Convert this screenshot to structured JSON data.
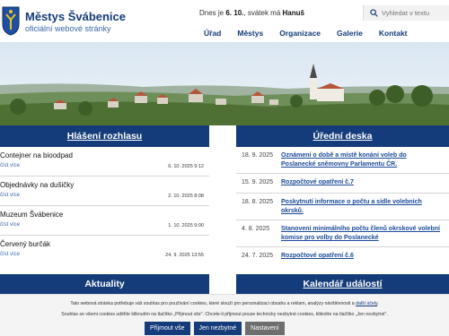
{
  "header": {
    "title": "Městys Švábenice",
    "subtitle": "oficiální webové stránky",
    "date_prefix": "Dnes je ",
    "date_value": "6. 10.",
    "date_mid": ", svátek má ",
    "name_day": "Hanuš"
  },
  "search": {
    "placeholder": "Vyhledat v textu",
    "icon": "search-icon"
  },
  "nav": [
    "Úřad",
    "Městys",
    "Organizace",
    "Galerie",
    "Kontakt"
  ],
  "announcements": {
    "heading": "Hlášení rozhlasu",
    "items": [
      {
        "title": "Contejner na bioodpad",
        "more": "číst více",
        "date": "6. 10. 2025 9:12"
      },
      {
        "title": "Objednávky na dušičky",
        "more": "číst více",
        "date": "2. 10. 2025 8:08"
      },
      {
        "title": "Muzeum Švábenice",
        "more": "číst více",
        "date": "1. 10. 2025 9:00"
      },
      {
        "title": "Červený burčák",
        "more": "číst více",
        "date": "24. 9. 2025 13:55"
      }
    ]
  },
  "board": {
    "heading": "Úřední deska",
    "items": [
      {
        "date": "18. 9. 2025",
        "title": "Oznámení o době a místě konání voleb do Poslanecké sněmovny Parlamentu ČR."
      },
      {
        "date": "15. 9. 2025",
        "title": "Rozpočtové opatření č.7"
      },
      {
        "date": "18. 8. 2025",
        "title": "Poskytnutí informace o počtu a sídle volebních okrsků."
      },
      {
        "date": "4. 8. 2025",
        "title": "Stanovení minimálního počtu členů okrskové volební komise pro volby do Poslanecké"
      },
      {
        "date": "24. 7. 2025",
        "title": "Rozpočtové opatření č.6"
      }
    ]
  },
  "sections": {
    "news": "Aktuality",
    "events": "Kalendář událostí"
  },
  "cookie": {
    "line1_a": "Tato webová stránka potřebuje váš souhlas pro používání cookies, které slouží pro personalizaci obsahu a reklam, analýzy návštěvnosti a ",
    "line1_link": "další účely",
    "line1_b": ".",
    "line2": "Souhlas se všemi cookies udělíte kliknutím na tlačítko „Přijmout vše\". Chcete-li přijmout pouze technicky nezbytné cookies, klikněte na tlačítko „Jen nezbytné\".",
    "accept": "Přijmout vše",
    "necessary": "Jen nezbytné",
    "settings": "Nastavení"
  },
  "colors": {
    "primary": "#143b7a",
    "link": "#1a4a9a"
  }
}
